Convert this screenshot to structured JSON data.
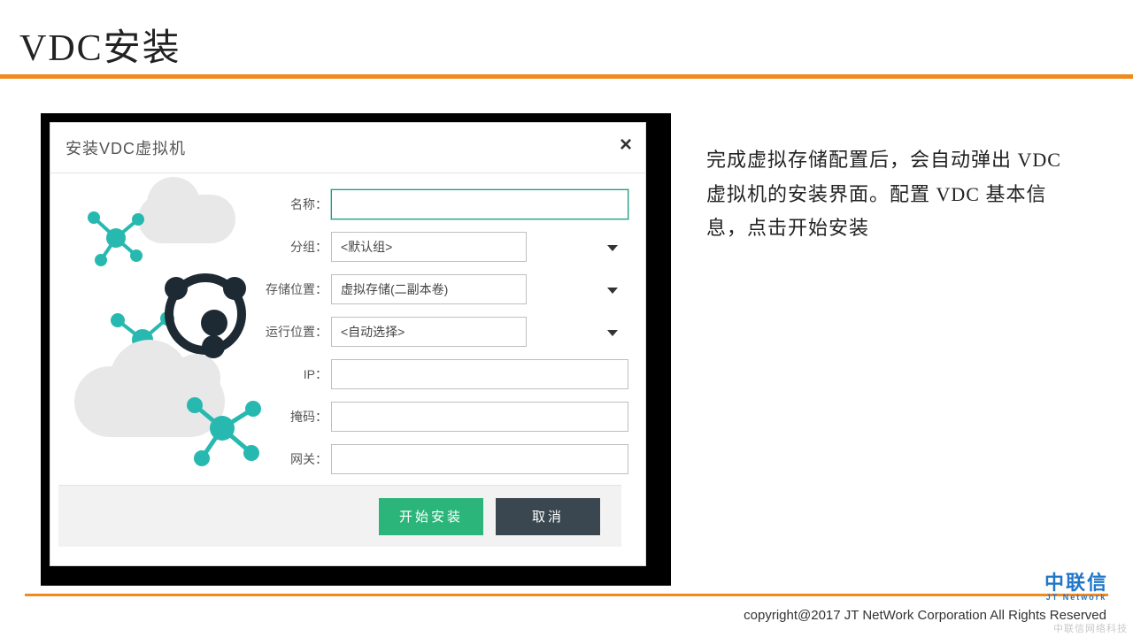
{
  "slide": {
    "title": "VDC安装",
    "description": "完成虚拟存储配置后，会自动弹出 VDC 虚拟机的安装界面。配置 VDC 基本信息，点击开始安装"
  },
  "dialog": {
    "title": "安装VDC虚拟机",
    "close": "×",
    "labels": {
      "name": "名称：",
      "group": "分组：",
      "storage": "存储位置：",
      "runloc": "运行位置：",
      "ip": "IP：",
      "mask": "掩码：",
      "gateway": "网关："
    },
    "values": {
      "name": "",
      "group": "<默认组>",
      "storage": "虚拟存储(二副本卷)",
      "runloc": "<自动选择>",
      "ip": "",
      "mask": "",
      "gateway": ""
    },
    "buttons": {
      "start": "开始安装",
      "cancel": "取消"
    }
  },
  "footer": {
    "copyright": "copyright@2017  JT NetWork Corporation All Rights Reserved",
    "brand_top": "中联信",
    "brand_sub": "JT Network",
    "watermark": "中联信网络科技"
  },
  "colors": {
    "accent": "#ef8a1e",
    "primary_btn": "#2cb57a",
    "secondary_btn": "#3a4750",
    "teal": "#27b9b0"
  }
}
